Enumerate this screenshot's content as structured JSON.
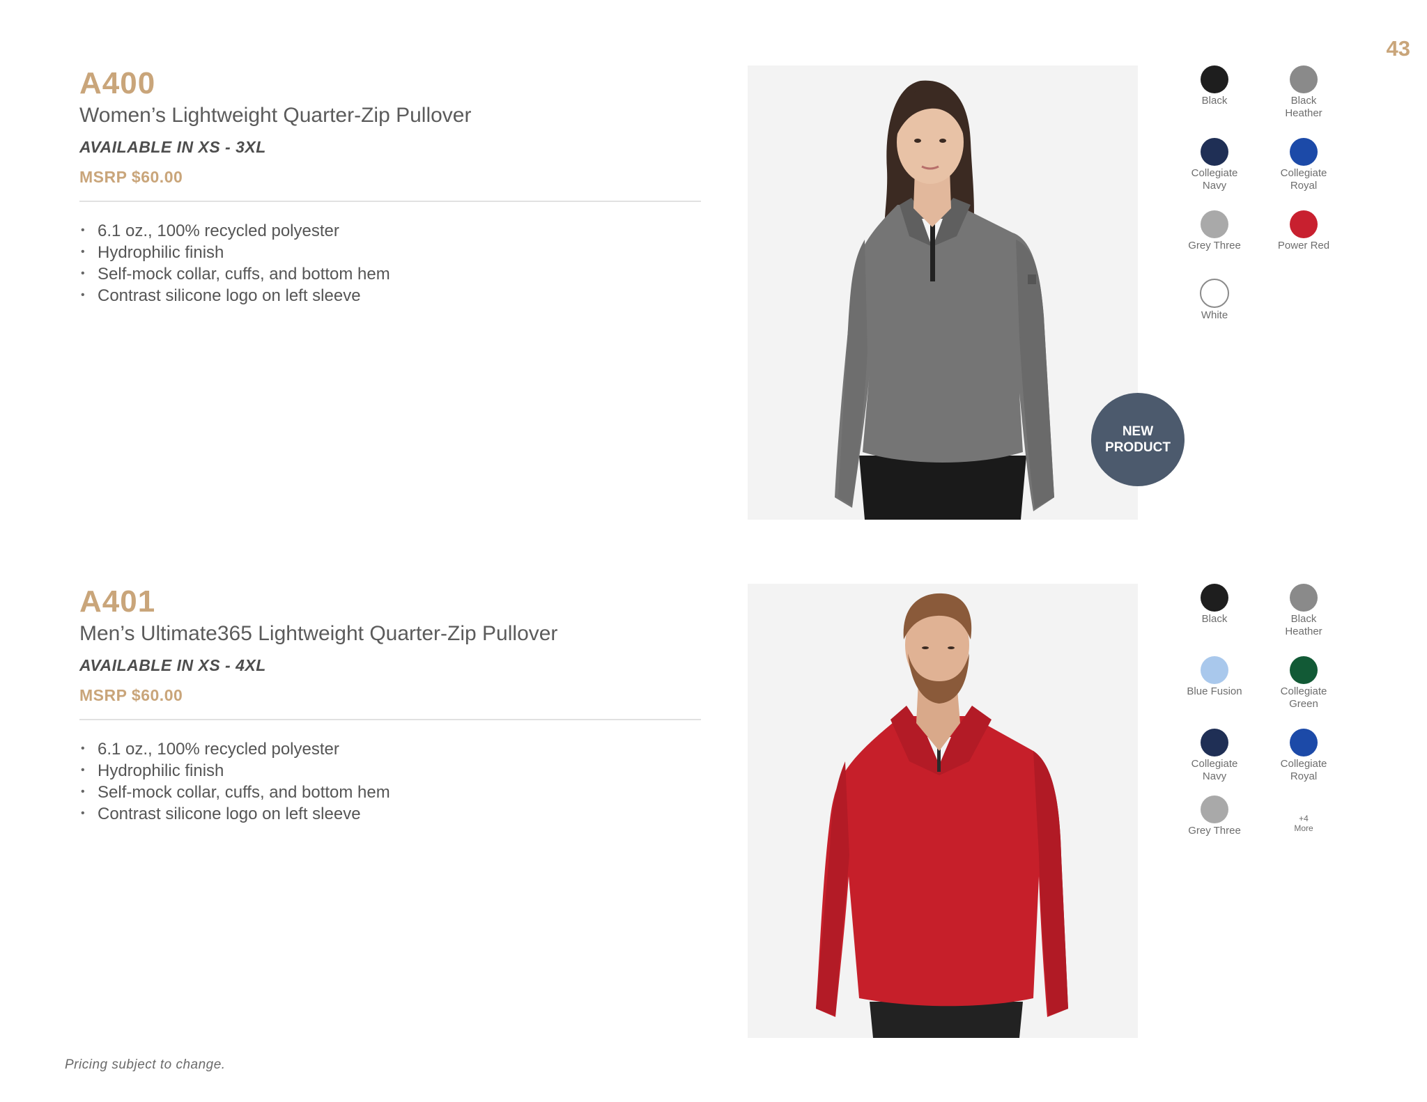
{
  "page_number": "43",
  "footer_note": "Pricing subject to change.",
  "products": [
    {
      "code": "A400",
      "name": "Women’s Lightweight Quarter-Zip Pullover",
      "sizes": "AVAILABLE IN XS - 3XL",
      "msrp": "MSRP $60.00",
      "features": [
        "6.1 oz., 100% recycled polyester",
        "Hydrophilic finish",
        "Self-mock collar, cuffs, and bottom hem",
        "Contrast silicone logo on left sleeve"
      ],
      "badge": {
        "line1": "NEW",
        "line2": "PRODUCT"
      },
      "colors": [
        {
          "name_line1": "Black",
          "name_line2": "",
          "hex": "#1e1e1e"
        },
        {
          "name_line1": "Black",
          "name_line2": "Heather",
          "hex": "#8a8a8a"
        },
        {
          "name_line1": "Collegiate",
          "name_line2": "Navy",
          "hex": "#1f2f55"
        },
        {
          "name_line1": "Collegiate",
          "name_line2": "Royal",
          "hex": "#1c4aa8"
        },
        {
          "name_line1": "Grey Three",
          "name_line2": "",
          "hex": "#a9a9a9"
        },
        {
          "name_line1": "Power Red",
          "name_line2": "",
          "hex": "#c8202f"
        },
        {
          "name_line1": "White",
          "name_line2": "",
          "hex": "#ffffff"
        }
      ]
    },
    {
      "code": "A401",
      "name": "Men’s Ultimate365 Lightweight Quarter-Zip Pullover",
      "sizes": "AVAILABLE IN XS - 4XL",
      "msrp": "MSRP $60.00",
      "features": [
        "6.1 oz., 100% recycled polyester",
        "Hydrophilic finish",
        "Self-mock collar, cuffs, and bottom hem",
        "Contrast silicone logo on left sleeve"
      ],
      "colors": [
        {
          "name_line1": "Black",
          "name_line2": "",
          "hex": "#1e1e1e"
        },
        {
          "name_line1": "Black",
          "name_line2": "Heather",
          "hex": "#8a8a8a"
        },
        {
          "name_line1": "Blue Fusion",
          "name_line2": "",
          "hex": "#a9c8ec"
        },
        {
          "name_line1": "Collegiate",
          "name_line2": "Green",
          "hex": "#125a36"
        },
        {
          "name_line1": "Collegiate",
          "name_line2": "Navy",
          "hex": "#1f2f55"
        },
        {
          "name_line1": "Collegiate",
          "name_line2": "Royal",
          "hex": "#1c4aa8"
        },
        {
          "name_line1": "Grey Three",
          "name_line2": "",
          "hex": "#a9a9a9"
        }
      ],
      "more": {
        "count": "+4",
        "label": "More"
      }
    }
  ]
}
